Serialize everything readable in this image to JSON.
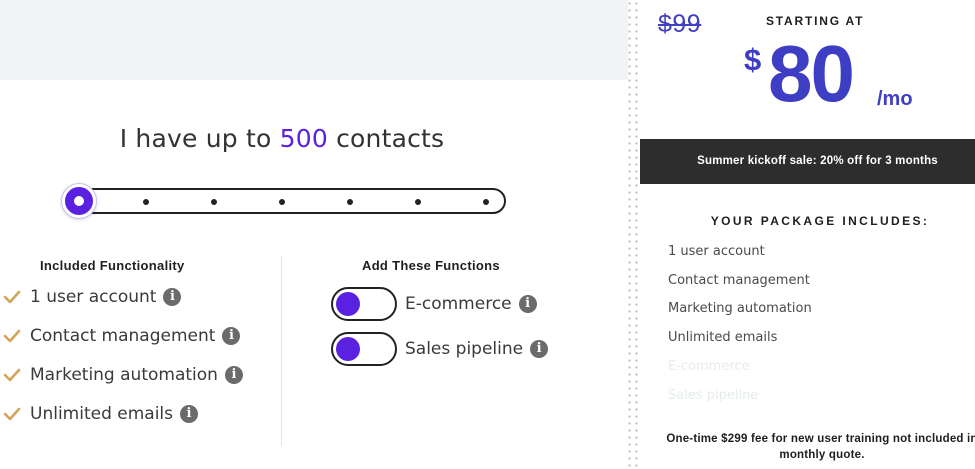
{
  "contacts": {
    "prefix": "I have up to ",
    "count": "500",
    "suffix": " contacts",
    "slider_position": 0,
    "slider_steps": 7
  },
  "included": {
    "title": "Included Functionality",
    "items": [
      {
        "label": "1 user account",
        "icon": "info-icon"
      },
      {
        "label": "Contact management",
        "icon": "info-icon"
      },
      {
        "label": "Marketing automation",
        "icon": "info-icon"
      },
      {
        "label": "Unlimited emails",
        "icon": "info-icon"
      }
    ]
  },
  "addons": {
    "title": "Add These Functions",
    "items": [
      {
        "label": "E-commerce",
        "enabled": false
      },
      {
        "label": "Sales pipeline",
        "enabled": false
      }
    ]
  },
  "pricing": {
    "old_price": "$99",
    "starting_label": "STARTING AT",
    "currency": "$",
    "price": "80",
    "period": "/mo",
    "accent_color": "#3e3ec4"
  },
  "sale_banner": "Summer kickoff sale: 20% off for 3 months",
  "package": {
    "title": "YOUR PACKAGE INCLUDES:",
    "items": [
      {
        "label": "1 user account",
        "active": true
      },
      {
        "label": "Contact management",
        "active": true
      },
      {
        "label": "Marketing automation",
        "active": true
      },
      {
        "label": "Unlimited emails",
        "active": true
      },
      {
        "label": "E-commerce",
        "active": false
      },
      {
        "label": "Sales pipeline",
        "active": false
      }
    ]
  },
  "footnote": "One-time $299 fee for new user training not included in monthly quote.",
  "colors": {
    "brand": "#5b21e0",
    "check": "#d4a456",
    "banner_bg": "#2d2d2d"
  }
}
